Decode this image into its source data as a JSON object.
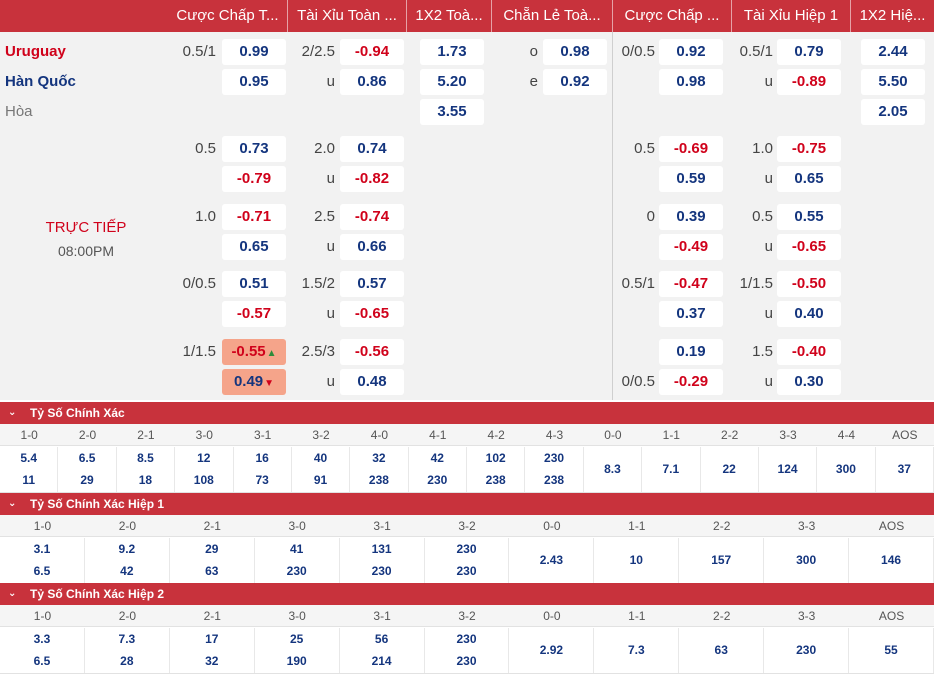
{
  "header": {
    "tabs": [
      "Cược Chấp T...",
      "Tài Xỉu Toàn ...",
      "1X2 Toà...",
      "Chẵn Lẻ Toà...",
      "Cược Chấp ...",
      "Tài Xỉu Hiệp 1",
      "1X2 Hiệ..."
    ]
  },
  "match": {
    "home": "Uruguay",
    "away": "Hàn Quốc",
    "draw": "Hòa",
    "status": "TRỰC TIẾP",
    "time": "08:00PM"
  },
  "odds": {
    "main_row": {
      "hcp_full": {
        "line": "0.5/1",
        "home": "0.99",
        "away": "0.95"
      },
      "ou_full": {
        "line": "2/2.5",
        "over": "-0.94",
        "u_label": "u",
        "under": "0.86"
      },
      "x12_full": {
        "home": "1.73",
        "away": "5.20",
        "draw": "3.55"
      },
      "oe_full": {
        "o_label": "o",
        "odd": "0.98",
        "e_label": "e",
        "even": "0.92"
      },
      "hcp_h1": {
        "line": "0/0.5",
        "home": "0.92",
        "away": "0.98"
      },
      "ou_h1": {
        "line": "0.5/1",
        "over": "0.79",
        "u_label": "u",
        "under": "-0.89"
      },
      "x12_h1": {
        "home": "2.44",
        "away": "5.50",
        "draw": "2.05"
      }
    },
    "extra_rows": [
      {
        "hcp_line": "0.5",
        "hcp_home": "0.73",
        "hcp_away": "-0.79",
        "ou_line": "2.0",
        "ou_over": "0.74",
        "ou_u": "u",
        "ou_under": "-0.82",
        "h1_hcp_line": "0.5",
        "h1_hcp_home": "-0.69",
        "h1_hcp_away": "0.59",
        "h1_ou_line": "1.0",
        "h1_ou_over": "-0.75",
        "h1_ou_u": "u",
        "h1_ou_under": "0.65"
      },
      {
        "hcp_line": "1.0",
        "hcp_home": "-0.71",
        "hcp_away": "0.65",
        "ou_line": "2.5",
        "ou_over": "-0.74",
        "ou_u": "u",
        "ou_under": "0.66",
        "h1_hcp_line": "0",
        "h1_hcp_home": "0.39",
        "h1_hcp_away": "-0.49",
        "h1_ou_line": "0.5",
        "h1_ou_over": "0.55",
        "h1_ou_u": "u",
        "h1_ou_under": "-0.65"
      },
      {
        "hcp_line": "0/0.5",
        "hcp_home": "0.51",
        "hcp_away": "-0.57",
        "ou_line": "1.5/2",
        "ou_over": "0.57",
        "ou_u": "u",
        "ou_under": "-0.65",
        "h1_hcp_line": "0.5/1",
        "h1_hcp_home": "-0.47",
        "h1_hcp_away": "0.37",
        "h1_ou_line": "1/1.5",
        "h1_ou_over": "-0.50",
        "h1_ou_u": "u",
        "h1_ou_under": "0.40"
      },
      {
        "hcp_line": "1/1.5",
        "hcp_home": "-0.55",
        "hcp_away": "0.49",
        "ou_line": "2.5/3",
        "ou_over": "-0.56",
        "ou_u": "u",
        "ou_under": "0.48",
        "h1_hcp_line": "0/0.5",
        "h1_hcp_home": "0.19",
        "h1_hcp_away": "-0.29",
        "h1_ou_line": "1.5",
        "h1_ou_over": "-0.40",
        "h1_ou_u": "u",
        "h1_ou_under": "0.30"
      }
    ],
    "arrow_up": "▲",
    "arrow_down": "▼"
  },
  "sections": [
    {
      "chevron": "⌄",
      "title": "Tỷ Số Chính Xác",
      "columns": [
        "1-0",
        "2-0",
        "2-1",
        "3-0",
        "3-1",
        "3-2",
        "4-0",
        "4-1",
        "4-2",
        "4-3",
        "0-0",
        "1-1",
        "2-2",
        "3-3",
        "4-4",
        "AOS"
      ],
      "row1": [
        "5.4",
        "6.5",
        "8.5",
        "12",
        "16",
        "40",
        "32",
        "42",
        "102",
        "230",
        "8.3",
        "7.1",
        "22",
        "124",
        "300",
        "37"
      ],
      "row2": [
        "11",
        "29",
        "18",
        "108",
        "73",
        "91",
        "238",
        "230",
        "238",
        "238",
        "",
        "",
        "",
        "",
        "",
        ""
      ]
    },
    {
      "chevron": "⌄",
      "title": "Tỷ Số Chính Xác Hiệp 1",
      "columns": [
        "1-0",
        "2-0",
        "2-1",
        "3-0",
        "3-1",
        "3-2",
        "0-0",
        "1-1",
        "2-2",
        "3-3",
        "AOS"
      ],
      "row1": [
        "3.1",
        "9.2",
        "29",
        "41",
        "131",
        "230",
        "2.43",
        "10",
        "157",
        "300",
        "146"
      ],
      "row2": [
        "6.5",
        "42",
        "63",
        "230",
        "230",
        "230",
        "",
        "",
        "",
        "",
        ""
      ]
    },
    {
      "chevron": "⌄",
      "title": "Tỷ Số Chính Xác Hiệp 2",
      "columns": [
        "1-0",
        "2-0",
        "2-1",
        "3-0",
        "3-1",
        "3-2",
        "0-0",
        "1-1",
        "2-2",
        "3-3",
        "AOS"
      ],
      "row1": [
        "3.3",
        "7.3",
        "17",
        "25",
        "56",
        "230",
        "2.92",
        "7.3",
        "63",
        "230",
        "55"
      ],
      "row2": [
        "6.5",
        "28",
        "32",
        "190",
        "214",
        "230",
        "",
        "",
        "",
        "",
        ""
      ]
    }
  ]
}
